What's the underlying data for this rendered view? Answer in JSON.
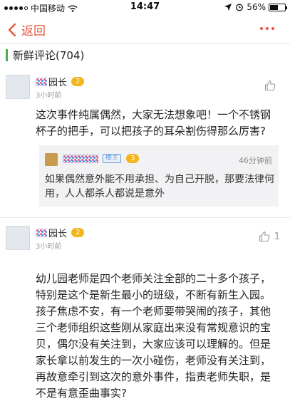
{
  "status_bar": {
    "carrier": "中国移动",
    "time": "14:47",
    "battery_text": "56%",
    "battery_level": 0.56
  },
  "nav": {
    "back_label": "返回"
  },
  "section": {
    "title": "新鲜评论(704)"
  },
  "comments": [
    {
      "name": "园长",
      "level": "2",
      "time": "3小时前",
      "likes": "",
      "text": "这次事件纯属偶然，大家无法想象吧！一个不锈钢杯子的把手，可以把孩子的耳朵割伤得那么厉害?",
      "reply": {
        "owner_tag": "楼主",
        "level": "3",
        "time": "46分钟前",
        "text": "如果偶然意外能不用承担、为自己开脱，那要法律何用，人人都杀人都说是意外"
      }
    },
    {
      "name": "园长",
      "level": "2",
      "time": "3小时前",
      "likes": "1",
      "text": "幼儿园老师是四个老师关注全部的二十多个孩子，特别是这个是新生最小的班级，不断有新生入园。孩子焦虑不安，有一个老师要带哭闹的孩子，其他三个老师组织这些刚从家庭出来没有常规意识的宝贝，偶尔没有关注到，大家应该可以理解的。但是家长拿以前发生的一次小碰伤，老师没有关注到，再故意牵引到这次的意外事件，指责老师失职，是不是有意歪曲事实?"
    }
  ],
  "colors": {
    "accent": "#e8563e",
    "section_bar": "#4cae4c",
    "level_badge": "#f2b51a",
    "owner_tag": "#5a9be8"
  }
}
